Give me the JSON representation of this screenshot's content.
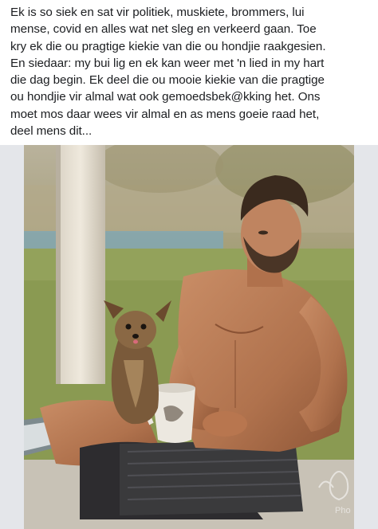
{
  "post": {
    "text": "Ek is so siek en sat vir politiek, muskiete, brommers, lui\nmense,  covid en alles wat net sleg en verkeerd gaan. Toe\nkry ek die ou pragtige kiekie van die ou hondjie raakgesien.\nEn siedaar: my bui lig en ek kan weer met 'n lied in my hart\ndie dag begin. Ek deel die ou mooie kiekie van die pragtige\nou hondjie vir almal wat ook gemoedsbek@kking het. Ons\nmoet mos daar wees vir almal en as mens goeie raad het,\ndeel mens dit..."
  },
  "photo": {
    "watermark": "Pho"
  },
  "colors": {
    "text": "#1c1e21",
    "frame": "#e4e6ea",
    "lawn": "#8a9a52",
    "skin": "#b87a55",
    "dog": "#7a5a3a"
  }
}
